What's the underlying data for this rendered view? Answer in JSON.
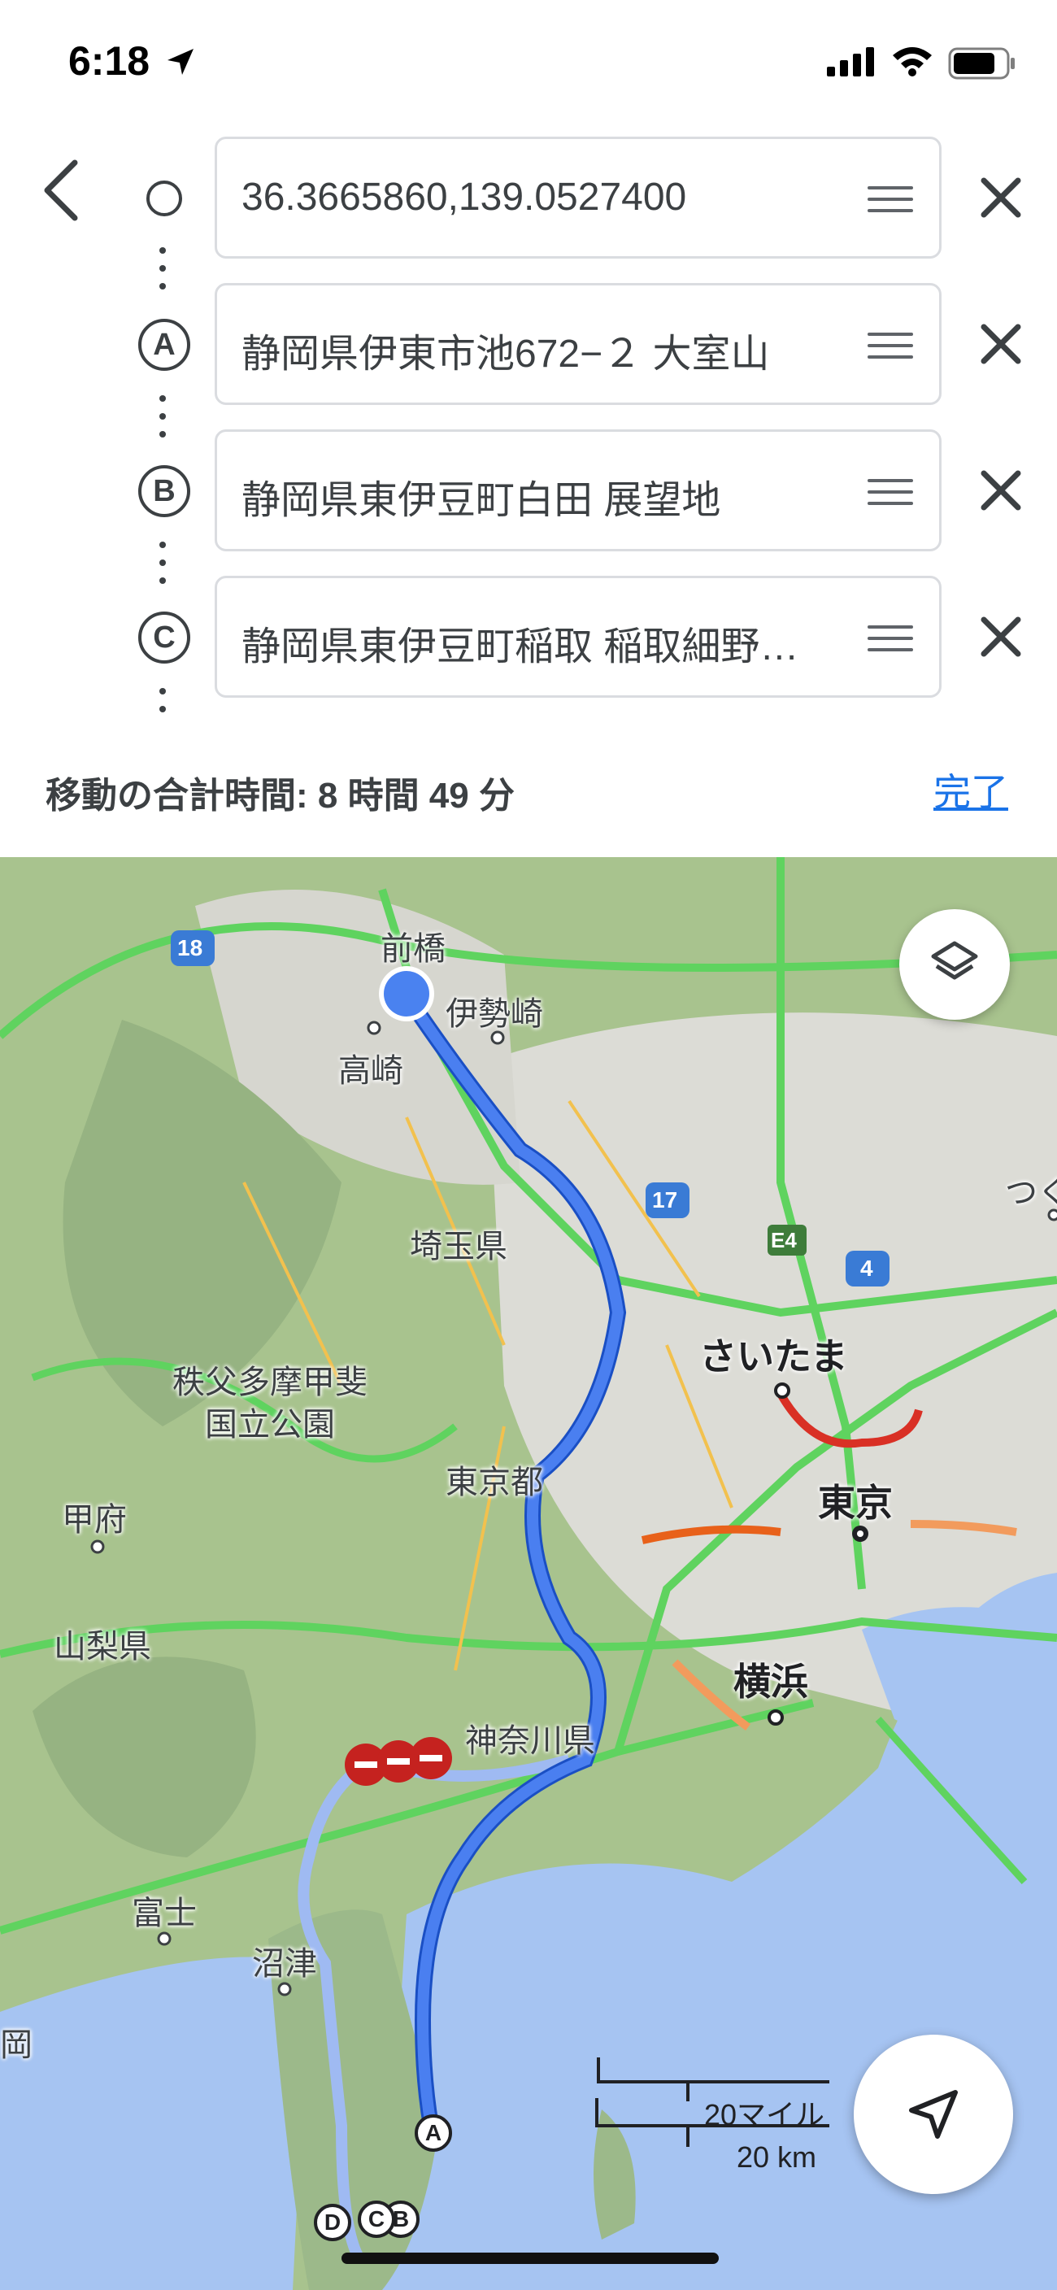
{
  "status_bar": {
    "time": "6:18"
  },
  "route": {
    "origin": {
      "value": "36.3665860,139.0527400"
    },
    "stops": [
      {
        "marker": "A",
        "value": "静岡県伊東市池672−２ 大室山"
      },
      {
        "marker": "B",
        "value": "静岡県東伊豆町白田 展望地"
      },
      {
        "marker": "C",
        "value": "静岡県東伊豆町稲取 稲取細野高原"
      }
    ]
  },
  "summary": {
    "total_time": "移動の合計時間: 8 時間 49 分",
    "done_label": "完了"
  },
  "map": {
    "labels": {
      "maebashi": "前橋",
      "isesaki": "伊勢崎",
      "takasaki": "高崎",
      "route18": "18",
      "route17": "17",
      "e4": "E4",
      "route4": "4",
      "tsuku": "つく",
      "saitama_pref": "埼玉県",
      "saitama": "さいたま",
      "chichibu": "秩父多摩甲斐\n国立公園",
      "tokyo_to": "東京都",
      "tokyo": "東京",
      "kofu": "甲府",
      "yamanashi": "山梨県",
      "yokohama": "横浜",
      "kanagawa": "神奈川県",
      "fuji": "富士",
      "numazu": "沼津",
      "oka": "岡"
    },
    "waypoints": [
      "A",
      "B",
      "C",
      "D"
    ],
    "scale": {
      "miles": "20マイル",
      "km": "20 km"
    }
  },
  "colors": {
    "route": "#4a7ff0",
    "route_alt": "#9fbaf2",
    "water": "#a6c4f2",
    "land": "#a8c38e",
    "link": "#1a73e8"
  }
}
